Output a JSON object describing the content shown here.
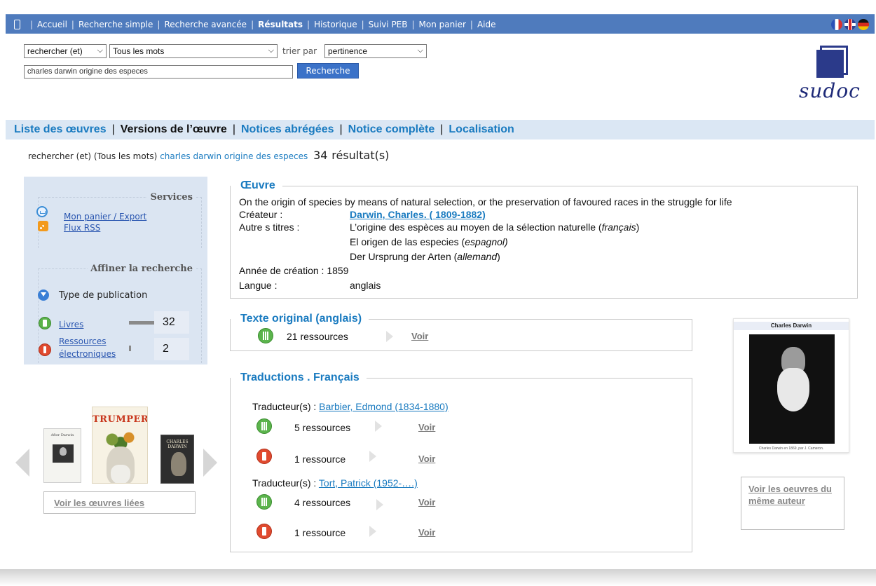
{
  "nav": {
    "items": [
      {
        "label": "Accueil"
      },
      {
        "label": "Recherche simple"
      },
      {
        "label": "Recherche avancée"
      },
      {
        "label": "Résultats"
      },
      {
        "label": "Historique"
      },
      {
        "label": "Suivi PEB"
      },
      {
        "label": "Mon panier"
      },
      {
        "label": "Aide"
      }
    ],
    "active": "Résultats",
    "flags": [
      "flag-fr",
      "flag-uk",
      "flag-de"
    ]
  },
  "search": {
    "operator": "rechercher (et)",
    "words_mode": "Tous les mots",
    "sort_label": "trier par",
    "sort_value": "pertinence",
    "query": "charles darwin origine des especes",
    "button": "Recherche"
  },
  "logo": {
    "text": "sudoc"
  },
  "tabs": [
    {
      "label": "Liste des œuvres"
    },
    {
      "label": "Versions de l’œuvre"
    },
    {
      "label": "Notices abrégées"
    },
    {
      "label": "Notice complète"
    },
    {
      "label": "Localisation"
    }
  ],
  "query_summary": {
    "prefix": "rechercher (et) (Tous les mots)",
    "terms": "charles darwin origine des especes",
    "count": "34",
    "suffix": "résultat(s)"
  },
  "sidebar": {
    "services_title": "Services",
    "basket_link": "Mon panier / Export",
    "rss_link": "Flux RSS",
    "refine_title": "Affiner la recherche",
    "pub_type_label": "Type de publication",
    "types": [
      {
        "label": "Livres",
        "count": "32"
      },
      {
        "label_line1": "Ressources",
        "label_line2": "électroniques",
        "count": "2"
      }
    ]
  },
  "carousel": {
    "covers": [
      {
        "title": "After Darwin"
      },
      {
        "title": "TRUMPERY"
      },
      {
        "title": "CHARLES DARWIN"
      }
    ],
    "related_button": "Voir les œuvres liées"
  },
  "work": {
    "legend": "Œuvre",
    "title": "On the origin of species by means of natural selection, or the preservation of favoured races in the struggle for life",
    "creator_label": "Créateur :",
    "creator": "Darwin, Charles. ( 1809-1882)",
    "other_titles_label": "Autre s titres :",
    "other_titles": [
      {
        "title": "L’origine des espèces au moyen de la sélection naturelle (",
        "lang": "français",
        "close": ")"
      },
      {
        "title": "El origen de las especies (",
        "lang": "espagnol)",
        "close": ""
      },
      {
        "title": "Der Ursprung der Arten (",
        "lang": "allemand",
        "close": ")"
      }
    ],
    "year_label": "Année de création :",
    "year": "1859",
    "language_label": "Langue :",
    "language": "anglais"
  },
  "original": {
    "legend": "Texte original (anglais)",
    "resources": "21 ressources",
    "voir": "Voir"
  },
  "translations": {
    "legend": "Traductions . Français",
    "translator_label": "Traducteur(s) :",
    "groups": [
      {
        "translator": "Barbier, Edmond (1834-1880)",
        "print": "5 ressources",
        "electronic": "1 ressource",
        "voir": "Voir"
      },
      {
        "translator": "Tort, Patrick  (1952-….)",
        "print": "4 ressources",
        "electronic": "1 ressource",
        "voir": "Voir"
      }
    ]
  },
  "portrait": {
    "title": "Charles Darwin",
    "caption": "Charles Darwin en 1869, par J. Cameron."
  },
  "same_author_button": "Voir les oeuvres du même auteur"
}
